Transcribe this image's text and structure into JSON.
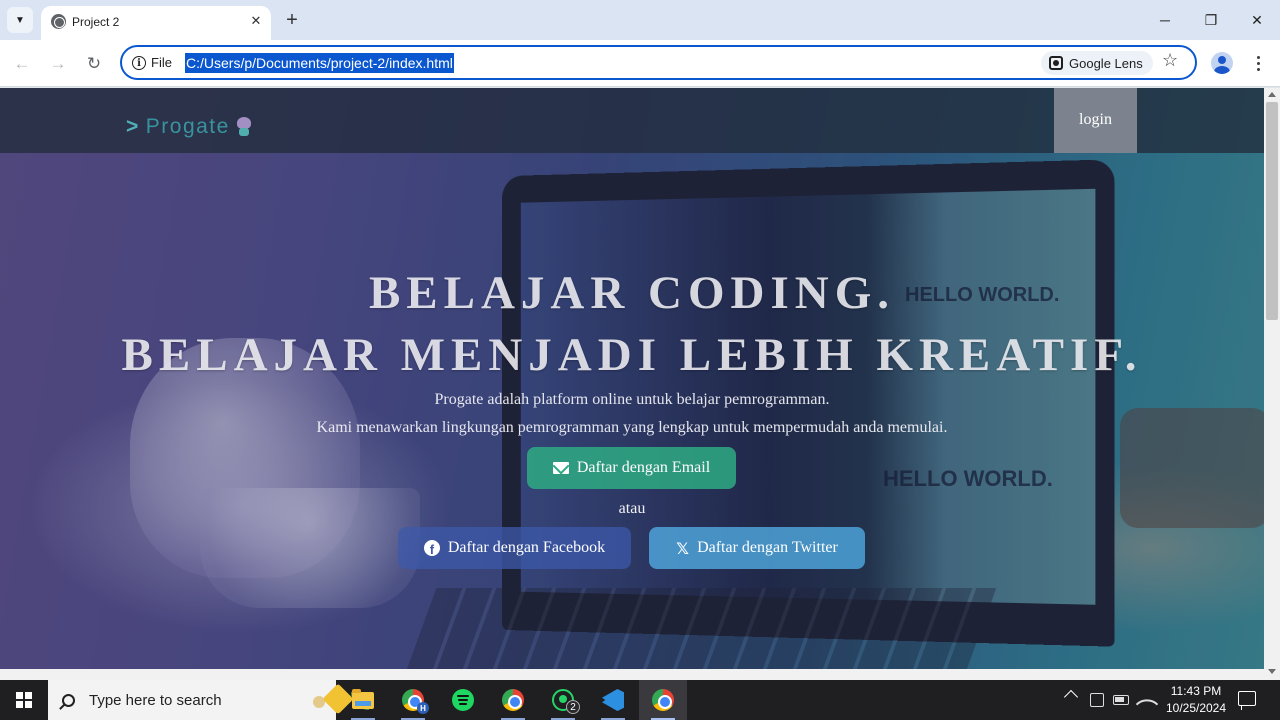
{
  "browser": {
    "tab_title": "Project 2",
    "file_label": "File",
    "url": "C:/Users/p/Documents/project-2/index.html",
    "lens_label": "Google Lens"
  },
  "site": {
    "logo_text": "Progate",
    "login_label": "login",
    "headline_1": "BELAJAR CODING.",
    "headline_2": "BELAJAR MENJADI LEBIH KREATIF.",
    "subtext_1": "Progate adalah platform online untuk belajar pemrogramman.",
    "subtext_2": "Kami menawarkan lingkungan pemrogramman yang lengkap untuk mempermudah anda memulai.",
    "email_button": "Daftar dengan Email",
    "or_text": "atau",
    "facebook_button": "Daftar dengan Facebook",
    "twitter_button": "Daftar dengan Twitter",
    "bg_screen_text_1": "HELLO WORLD.",
    "bg_screen_text_2": "HELLO WORLD."
  },
  "taskbar": {
    "search_placeholder": "Type here to search",
    "chrome_profile_badge": "H",
    "whatsapp_badge": "2",
    "time": "11:43 PM",
    "date": "10/25/2024"
  },
  "icons": {
    "back": "arrow-left-icon",
    "forward": "arrow-right-icon",
    "reload": "reload-icon",
    "bookmark": "star-icon",
    "email": "envelope-icon",
    "facebook": "facebook-icon",
    "twitter": "x-icon"
  },
  "colors": {
    "omnibox_accent": "#0b57d0",
    "email_button": "#2eaa82",
    "facebook_button": "#3e5aaa",
    "twitter_button": "#50aae1",
    "logo": "#4fc1c8"
  }
}
